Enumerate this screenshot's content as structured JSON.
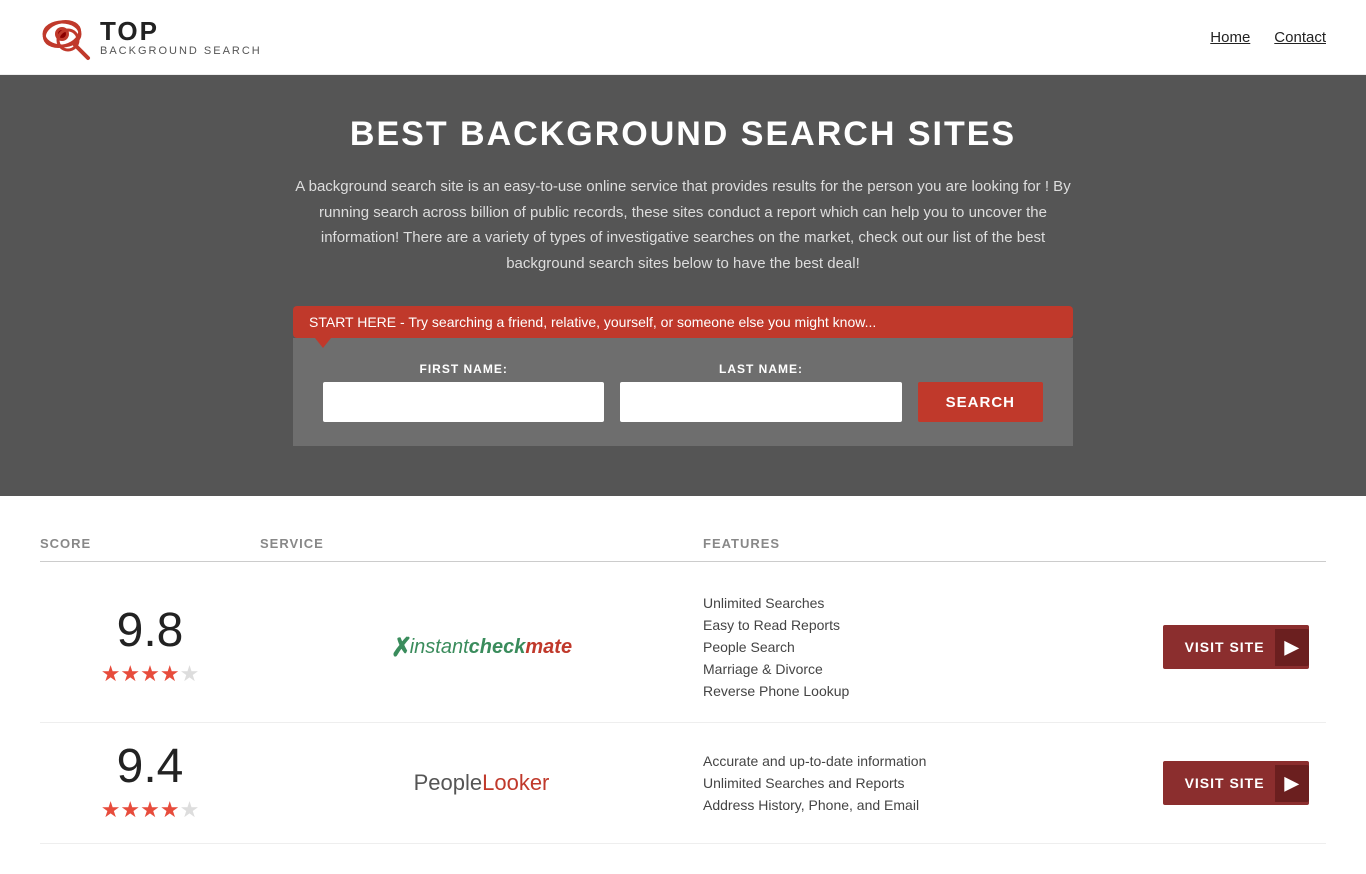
{
  "header": {
    "logo_top": "TOP",
    "logo_sub": "BACKGROUND SEARCH",
    "nav_home": "Home",
    "nav_contact": "Contact"
  },
  "hero": {
    "title": "BEST BACKGROUND SEARCH SITES",
    "description": "A background search site is an easy-to-use online service that provides results  for the person you are looking for ! By  running  search across billion of public records, these sites conduct  a report which can help you to uncover the information! There are a variety of types of investigative searches on the market, check out our  list of the best background search sites below to have the best deal!",
    "bubble_text": "START HERE - Try searching a friend, relative, yourself, or someone else you might know...",
    "first_name_label": "FIRST NAME:",
    "last_name_label": "LAST NAME:",
    "search_btn": "SEARCH"
  },
  "table": {
    "col_score": "SCORE",
    "col_service": "SERVICE",
    "col_features": "FEATURES",
    "rows": [
      {
        "score": "9.8",
        "stars": "★★★★★",
        "service_name": "InstantCheckmate",
        "features": [
          "Unlimited Searches",
          "Easy to Read Reports",
          "People Search",
          "Marriage & Divorce",
          "Reverse Phone Lookup"
        ],
        "visit_label": "VISIT SITE"
      },
      {
        "score": "9.4",
        "stars": "★★★★★",
        "service_name": "PeopleLooker",
        "features": [
          "Accurate and up-to-date information",
          "Unlimited Searches and Reports",
          "Address History, Phone, and Email"
        ],
        "visit_label": "VISIT SITE"
      }
    ]
  }
}
